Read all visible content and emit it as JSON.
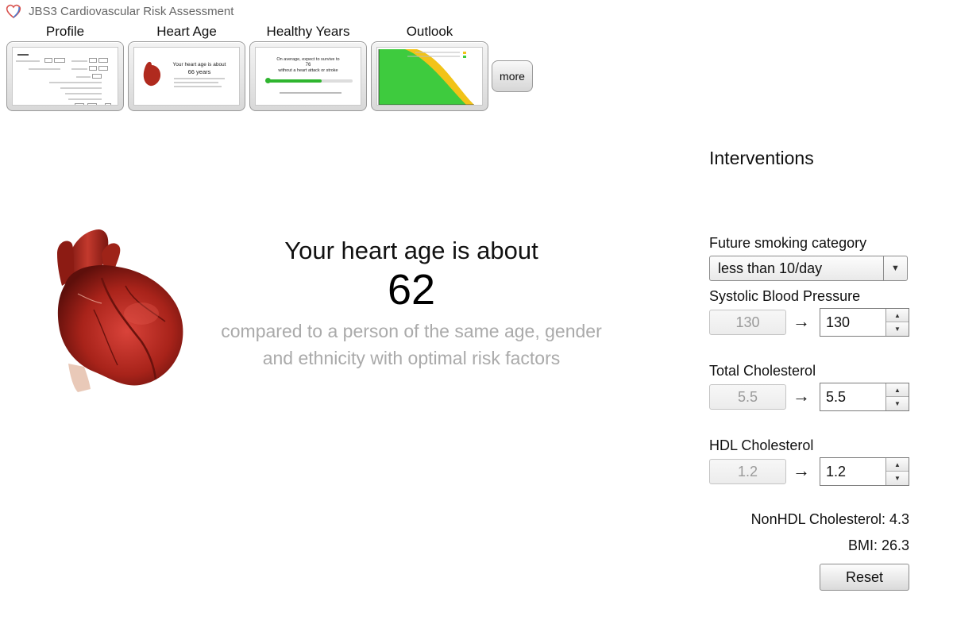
{
  "app": {
    "title": "JBS3 Cardiovascular Risk Assessment",
    "logo_icon": "heart-outline-icon"
  },
  "tabs": [
    {
      "label": "Profile"
    },
    {
      "label": "Heart Age",
      "thumb_title": "Your heart age is about",
      "thumb_age": "66 years"
    },
    {
      "label": "Healthy Years",
      "thumb_line1": "On average, expect to survive to",
      "thumb_value": "76",
      "thumb_line2": "without a heart attack or stroke"
    },
    {
      "label": "Outlook"
    }
  ],
  "more_label": "more",
  "result": {
    "headline": "Your heart age is about",
    "age": "62",
    "compare_line1": "compared to a person of the same age, gender",
    "compare_line2": "and ethnicity with optimal risk factors"
  },
  "interventions": {
    "title": "Interventions",
    "smoking": {
      "label": "Future smoking category",
      "value": "less than 10/day"
    },
    "sbp": {
      "label": "Systolic Blood Pressure",
      "current": "130",
      "target": "130"
    },
    "total_chol": {
      "label": "Total Cholesterol",
      "current": "5.5",
      "target": "5.5"
    },
    "hdl_chol": {
      "label": "HDL Cholesterol",
      "current": "1.2",
      "target": "1.2"
    },
    "arrow": "→",
    "nonhdl": "NonHDL Cholesterol: 4.3",
    "bmi": "BMI: 26.3",
    "reset_label": "Reset"
  },
  "colors": {
    "muted_text": "#aaaaaa",
    "outlook_green": "#3ecb3e",
    "outlook_yellow": "#f2c318",
    "slider_green": "#2fb52f"
  }
}
